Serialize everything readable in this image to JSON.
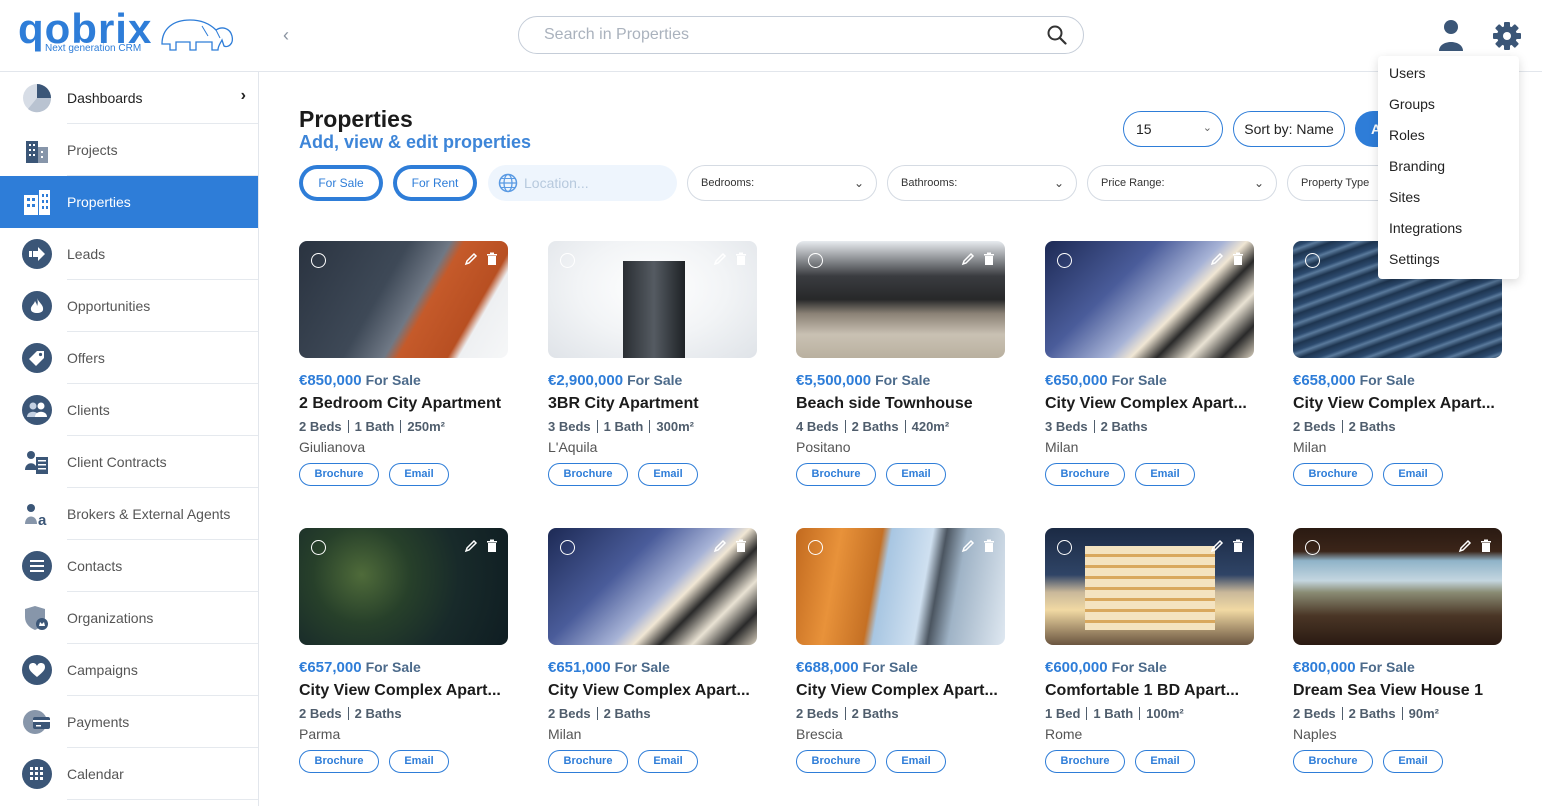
{
  "header": {
    "logo_text": "qobrix",
    "logo_tagline": "Next generation CRM",
    "search_placeholder": "Search in Properties"
  },
  "sidebar": {
    "items": [
      {
        "label": "Dashboards",
        "icon": "pie-chart-icon"
      },
      {
        "label": "Projects",
        "icon": "buildings-icon"
      },
      {
        "label": "Properties",
        "icon": "building-icon"
      },
      {
        "label": "Leads",
        "icon": "arrow-right-icon"
      },
      {
        "label": "Opportunities",
        "icon": "fire-icon"
      },
      {
        "label": "Offers",
        "icon": "tag-icon"
      },
      {
        "label": "Clients",
        "icon": "users-icon"
      },
      {
        "label": "Client Contracts",
        "icon": "contract-icon"
      },
      {
        "label": "Brokers & External Agents",
        "icon": "agent-icon"
      },
      {
        "label": "Contacts",
        "icon": "list-icon"
      },
      {
        "label": "Organizations",
        "icon": "shield-icon"
      },
      {
        "label": "Campaigns",
        "icon": "heart-icon"
      },
      {
        "label": "Payments",
        "icon": "credit-card-icon"
      },
      {
        "label": "Calendar",
        "icon": "calendar-icon"
      }
    ],
    "active": "Properties"
  },
  "main": {
    "title": "Properties",
    "subtitle": "Add, view & edit properties",
    "per_page": "15",
    "sort_label": "Sort by: Name",
    "add_label": "A",
    "filters": {
      "for_sale": "For Sale",
      "for_rent": "For Rent",
      "location_placeholder": "Location...",
      "bedrooms": "Bedrooms:",
      "bathrooms": "Bathrooms:",
      "price_range": "Price Range:",
      "property_type": "Property Type"
    }
  },
  "properties": [
    {
      "price": "€850,000",
      "status": "For Sale",
      "title": "2 Bedroom City Apartment",
      "specs": [
        "2 Beds",
        "1 Bath",
        "250m²"
      ],
      "city": "Giulianova"
    },
    {
      "price": "€2,900,000",
      "status": "For Sale",
      "title": "3BR City Apartment",
      "specs": [
        "3 Beds",
        "1 Bath",
        "300m²"
      ],
      "city": "L'Aquila"
    },
    {
      "price": "€5,500,000",
      "status": "For Sale",
      "title": "Beach side Townhouse",
      "specs": [
        "4 Beds",
        "2 Baths",
        "420m²"
      ],
      "city": "Positano"
    },
    {
      "price": "€650,000",
      "status": "For Sale",
      "title": "City View Complex Apart...",
      "specs": [
        "3 Beds",
        "2 Baths"
      ],
      "city": "Milan"
    },
    {
      "price": "€658,000",
      "status": "For Sale",
      "title": "City View Complex Apart...",
      "specs": [
        "2 Beds",
        "2 Baths"
      ],
      "city": "Milan"
    },
    {
      "price": "€657,000",
      "status": "For Sale",
      "title": "City View Complex Apart...",
      "specs": [
        "2 Beds",
        "2 Baths"
      ],
      "city": "Parma"
    },
    {
      "price": "€651,000",
      "status": "For Sale",
      "title": "City View Complex Apart...",
      "specs": [
        "2 Beds",
        "2 Baths"
      ],
      "city": "Milan"
    },
    {
      "price": "€688,000",
      "status": "For Sale",
      "title": "City View Complex Apart...",
      "specs": [
        "2 Beds",
        "2 Baths"
      ],
      "city": "Brescia"
    },
    {
      "price": "€600,000",
      "status": "For Sale",
      "title": "Comfortable 1 BD Apart...",
      "specs": [
        "1 Bed",
        "1 Bath",
        "100m²"
      ],
      "city": "Rome"
    },
    {
      "price": "€800,000",
      "status": "For Sale",
      "title": "Dream Sea View House 1",
      "specs": [
        "2 Beds",
        "2 Baths",
        "90m²"
      ],
      "city": "Naples"
    }
  ],
  "card_buttons": {
    "brochure": "Brochure",
    "email": "Email"
  },
  "settings_menu": [
    "Users",
    "Groups",
    "Roles",
    "Branding",
    "Sites",
    "Integrations",
    "Settings"
  ],
  "colors": {
    "accent": "#2e7dd8",
    "nav_icon": "#3b5677",
    "muted": "#4c6a8a"
  }
}
